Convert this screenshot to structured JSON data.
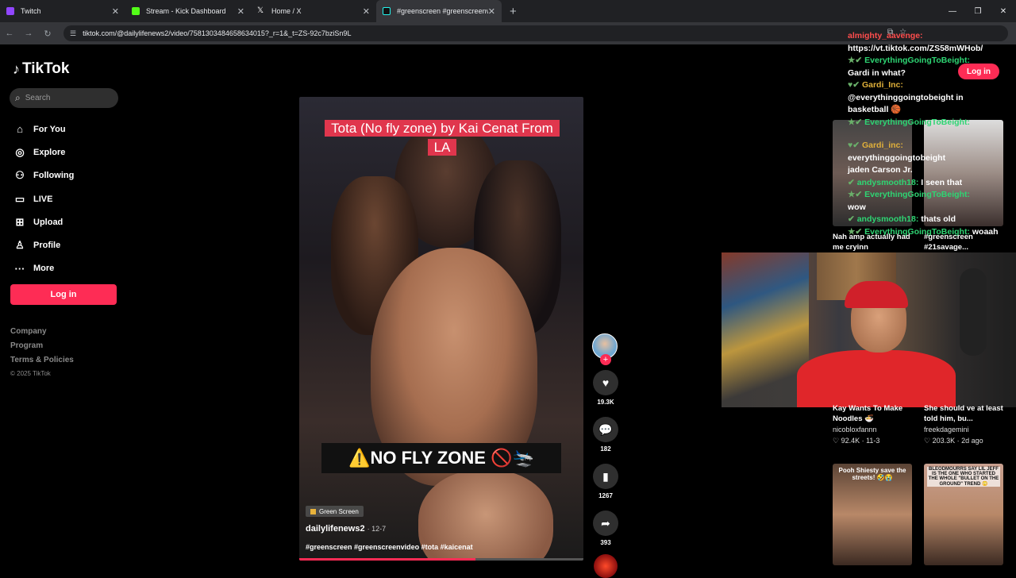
{
  "browser": {
    "tabs": [
      {
        "title": "Twitch",
        "color": "#9146ff"
      },
      {
        "title": "Stream - Kick Dashboard",
        "color": "#53fc18"
      },
      {
        "title": "Home / X",
        "color": "#ffffff"
      },
      {
        "title": "#greenscreen #greenscreenvid",
        "color": "#ffffff"
      }
    ],
    "url": "tiktok.com/@dailylifenews2/video/7581303484658634015?_r=1&_t=ZS-92c7bziSn9L"
  },
  "tiktok": {
    "logo": "TikTok",
    "search_placeholder": "Search",
    "nav": [
      {
        "icon": "⌂",
        "label": "For You"
      },
      {
        "icon": "◎",
        "label": "Explore"
      },
      {
        "icon": "⚇",
        "label": "Following"
      },
      {
        "icon": "▭",
        "label": "LIVE"
      },
      {
        "icon": "⊞",
        "label": "Upload"
      },
      {
        "icon": "♙",
        "label": "Profile"
      },
      {
        "icon": "···",
        "label": "More"
      }
    ],
    "login": "Log in",
    "footer": [
      "Company",
      "Program",
      "Terms & Policies"
    ],
    "copyright": "© 2025 TikTok"
  },
  "video": {
    "caption_top": "Tota (No fly zone) by Kai Cenat From LA",
    "overlay_text": "⚠️NO FLY ZONE 🚫🛬",
    "badge": "Green Screen",
    "author": "dailylifenews2",
    "date": "· 12-7",
    "hashtags": "#greenscreen #greenscreenvideo #tota #kaicenat",
    "progress_fraction": 0.62
  },
  "actions": {
    "likes": "19.3K",
    "comments": "182",
    "saves": "1267",
    "shares": "393"
  },
  "right": {
    "login": "Log in",
    "chat": [
      {
        "name": "almighty_aavenge:",
        "cls": "r",
        "msg": "https://vt.tiktok.com/ZS58mWHob/"
      },
      {
        "name": "EverythingGoingToBeight:",
        "cls": "",
        "msg": "Gardi in what?"
      },
      {
        "name": "Gardi_Inc:",
        "cls": "y",
        "msg": "@everythinggoingtobeight in basketball 🏀"
      },
      {
        "name": "EverythingGoingToBeight:",
        "cls": "",
        "msg": ""
      },
      {
        "name": "Gardi_inc:",
        "cls": "y",
        "msg": "everythinggoingtobeight jaden Carson Jr."
      },
      {
        "name": "andysmooth18:",
        "cls": "",
        "msg": "I seen that"
      },
      {
        "name": "EverythingGoingToBeight:",
        "cls": "",
        "msg": "wow"
      },
      {
        "name": "andysmooth18:",
        "cls": "",
        "msg": "thats old"
      },
      {
        "name": "EverythingGoingToBeight:",
        "cls": "",
        "msg": "woaah"
      }
    ],
    "cards": [
      {
        "title": "Nah amp actually had me cryinn",
        "meta": ""
      },
      {
        "title": "#greenscreen #21savage...",
        "meta": ""
      },
      {
        "title": "Kay Wants To Make Noodles 🍜",
        "author": "nicobloxfannn",
        "meta": "♡ 92.4K · 11-3"
      },
      {
        "title": "She should ve at least told him, bu...",
        "author": "freekdagemini",
        "meta": "♡ 203.3K · 2d ago"
      },
      {
        "thumb_title": "Pooh Shiesty save the streets! 🤣😭"
      },
      {
        "thumb_title": "BLEODMOURRS SAY LIL JEFF IS THE ONE WHO STARTED THE WHOLE \"BULLET ON THE GROUND\" TREND 😳"
      }
    ]
  }
}
